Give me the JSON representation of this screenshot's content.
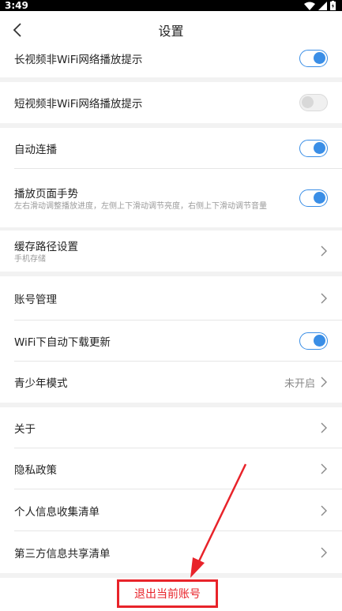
{
  "status_bar": {
    "time": "3:49"
  },
  "nav": {
    "title": "设置"
  },
  "rows": {
    "long_video": {
      "label": "长视频非WiFi网络播放提示",
      "toggle": "on"
    },
    "short_video": {
      "label": "短视频非WiFi网络播放提示",
      "toggle": "off"
    },
    "autoplay": {
      "label": "自动连播",
      "toggle": "on"
    },
    "gesture": {
      "label": "播放页面手势",
      "sub": "左右滑动调整播放进度，左侧上下滑动调节亮度，右侧上下滑动调节音量",
      "toggle": "on"
    },
    "cache": {
      "label": "缓存路径设置",
      "sub": "手机存储"
    },
    "account": {
      "label": "账号管理"
    },
    "wifi_update": {
      "label": "WiFi下自动下载更新",
      "toggle": "on"
    },
    "youth": {
      "label": "青少年模式",
      "value": "未开启"
    },
    "about": {
      "label": "关于"
    },
    "privacy": {
      "label": "隐私政策"
    },
    "personal_info": {
      "label": "个人信息收集清单"
    },
    "third_party": {
      "label": "第三方信息共享清单"
    }
  },
  "logout": {
    "label": "退出当前账号"
  },
  "colors": {
    "toggle_on": "#3a8ee6",
    "annotation": "#e8232a"
  }
}
